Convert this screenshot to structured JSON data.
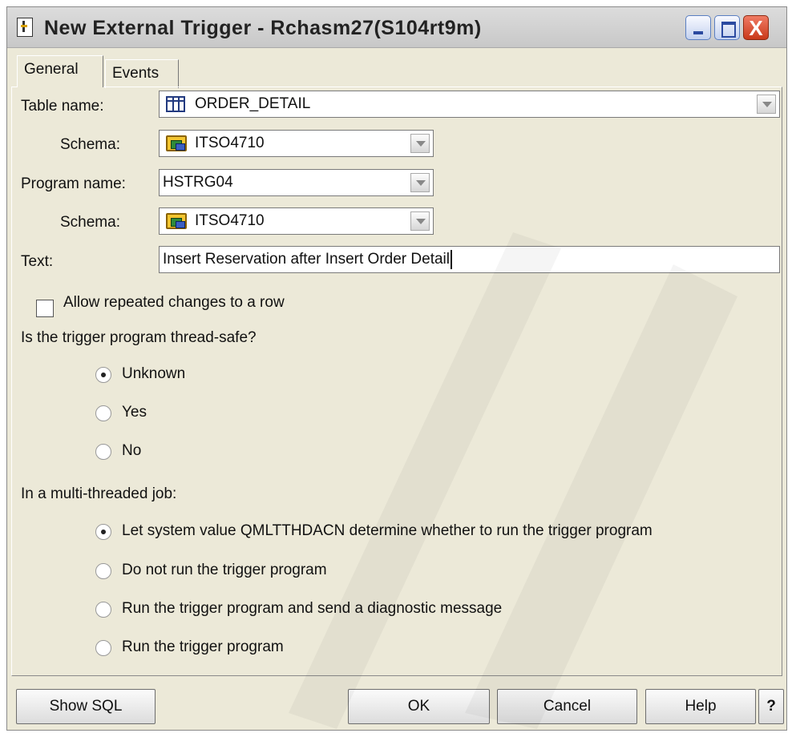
{
  "window": {
    "title": "New External Trigger - Rchasm27(S104rt9m)",
    "controls": {
      "minimize": "minimize",
      "maximize": "maximize",
      "close": "X"
    }
  },
  "tabs": [
    {
      "label": "General",
      "active": true
    },
    {
      "label": "Events",
      "active": false
    }
  ],
  "form": {
    "table_name": {
      "label": "Table name:",
      "value": "ORDER_DETAIL",
      "icon": "table-icon"
    },
    "table_schema": {
      "label": "Schema:",
      "value": "ITSO4710",
      "icon": "schema-icon"
    },
    "program_name": {
      "label": "Program name:",
      "value": "HSTRG04"
    },
    "program_schema": {
      "label": "Schema:",
      "value": "ITSO4710",
      "icon": "schema-icon"
    },
    "text": {
      "label": "Text:",
      "value": "Insert Reservation after Insert Order Detail"
    },
    "allow_repeated": {
      "label": "Allow repeated changes to a row",
      "checked": false
    }
  },
  "thread_safe": {
    "question": "Is the trigger program thread-safe?",
    "options": [
      {
        "label": "Unknown",
        "selected": true
      },
      {
        "label": "Yes",
        "selected": false
      },
      {
        "label": "No",
        "selected": false
      }
    ]
  },
  "multithread": {
    "question": "In a multi-threaded job:",
    "options": [
      {
        "label": "Let system value QMLTTHDACN determine whether to run the trigger program",
        "selected": true
      },
      {
        "label": "Do not run the trigger program",
        "selected": false
      },
      {
        "label": "Run the trigger program and send a diagnostic message",
        "selected": false
      },
      {
        "label": "Run the trigger program",
        "selected": false
      }
    ]
  },
  "buttons": {
    "show_sql": "Show SQL",
    "ok": "OK",
    "cancel": "Cancel",
    "help": "Help",
    "context_help": "?"
  }
}
